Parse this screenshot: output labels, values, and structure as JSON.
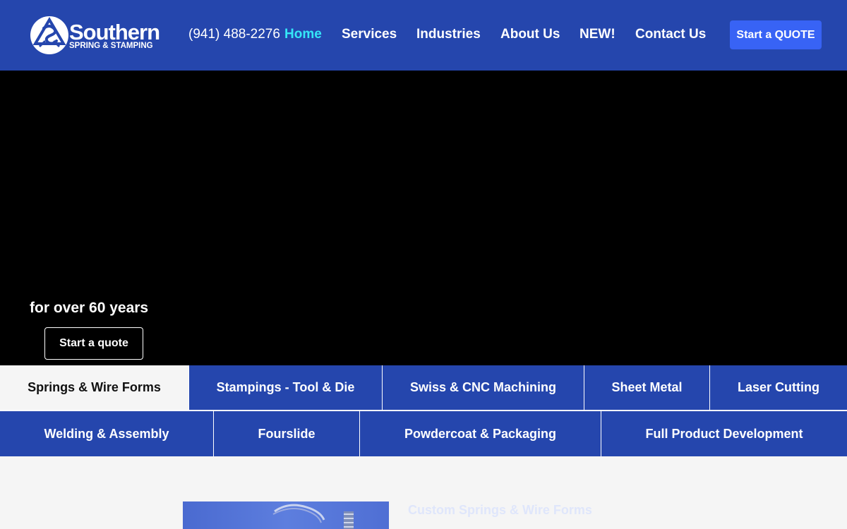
{
  "header": {
    "logo": {
      "name": "Southern",
      "subtitle": "SPRING & STAMPING"
    },
    "phone": "(941) 488-2276",
    "nav": [
      {
        "label": "Home",
        "active": true
      },
      {
        "label": "Services",
        "active": false
      },
      {
        "label": "Industries",
        "active": false
      },
      {
        "label": "About Us",
        "active": false
      },
      {
        "label": "NEW!",
        "active": false
      },
      {
        "label": "Contact Us",
        "active": false
      }
    ],
    "cta_label": "Start a QUOTE"
  },
  "hero": {
    "tagline": "for over 60 years",
    "button_label": "Start a quote"
  },
  "tabs_row1": [
    {
      "label": "Springs & Wire Forms",
      "active": true
    },
    {
      "label": "Stampings - Tool & Die",
      "active": false
    },
    {
      "label": "Swiss & CNC Machining",
      "active": false
    },
    {
      "label": "Sheet Metal",
      "active": false
    },
    {
      "label": "Laser Cutting",
      "active": false
    }
  ],
  "tabs_row2": [
    {
      "label": "Welding & Assembly",
      "active": false
    },
    {
      "label": "Fourslide",
      "active": false
    },
    {
      "label": "Powdercoat & Packaging",
      "active": false
    },
    {
      "label": "Full Product Development",
      "active": false
    }
  ],
  "content": {
    "section_title": "Custom Springs & Wire Forms"
  },
  "colors": {
    "brand_blue": "#2546ad",
    "cta_blue": "#3863f5",
    "active_nav": "#35e6f7"
  }
}
